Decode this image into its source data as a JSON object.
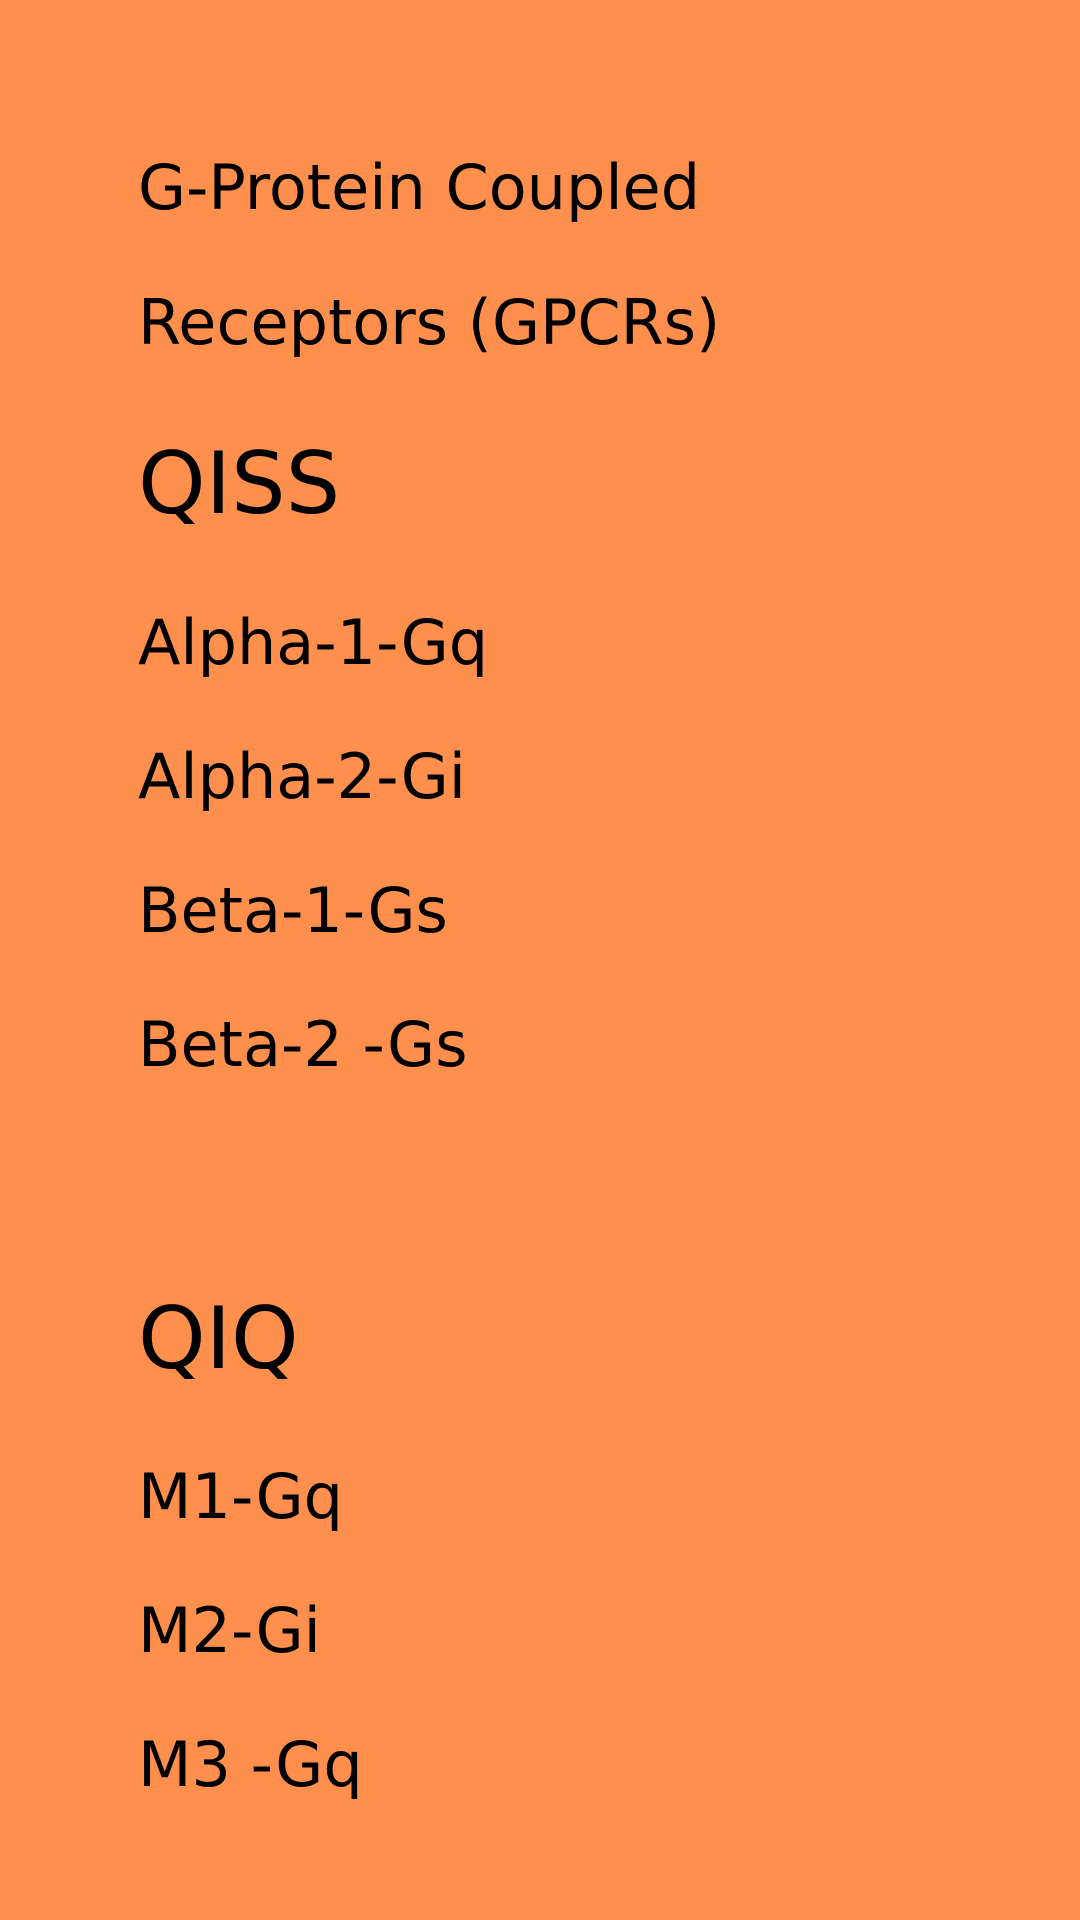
{
  "page": {
    "background_color": "#FF8F4C",
    "text_color": "#000000",
    "title_lines": [
      "G-Protein Coupled",
      "Receptors (GPCRs)"
    ],
    "sections": [
      {
        "heading": "QISS",
        "items": [
          "Alpha-1-Gq",
          "Alpha-2-Gi",
          "Beta-1-Gs",
          "Beta-2 -Gs"
        ]
      },
      {
        "heading": "QIQ",
        "items": [
          "M1-Gq",
          "M2-Gi",
          "M3 -Gq"
        ]
      }
    ]
  }
}
